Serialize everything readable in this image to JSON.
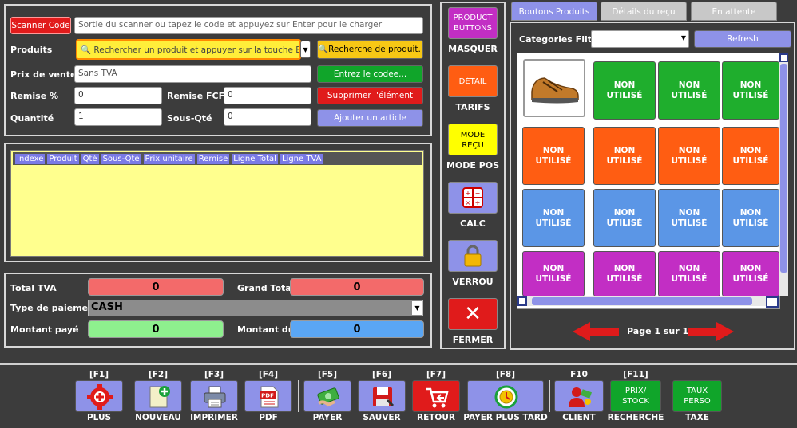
{
  "scanner": {
    "button": "Scanner Code",
    "placeholder": "Sortie du scanner ou tapez le code et appuyez sur Enter pour le charger"
  },
  "produits": {
    "label": "Produits",
    "placeholder": "Rechercher un produit et appuyer sur la touche Ente...",
    "search_button": "Recherche de produit..."
  },
  "prix_vente": {
    "label": "Prix de vente",
    "value": "Sans TVA",
    "button": "Entrez le codee..."
  },
  "remise": {
    "label": "Remise %",
    "value": "0",
    "fcfa_label": "Remise FCFA",
    "fcfa_value": "0",
    "button": "Supprimer l'élément"
  },
  "quantite": {
    "label": "Quantité",
    "value": "1",
    "sous_label": "Sous-Qté",
    "sous_value": "0",
    "button": "Ajouter un article"
  },
  "table": {
    "columns": [
      "Indexe",
      "Produit",
      "Qté",
      "Sous-Qté",
      "Prix unitaire",
      "Remise",
      "Ligne Total",
      "Ligne TVA"
    ]
  },
  "totals": {
    "tva_label": "Total TVA",
    "tva_value": "0",
    "grand_label": "Grand Total",
    "grand_value": "0",
    "paiement_label": "Type de paiement",
    "paiement_value": "CASH",
    "paye_label": "Montant payé",
    "paye_value": "0",
    "du_label": "Montant dû",
    "du_value": "0"
  },
  "side": {
    "product_buttons": "PRODUCT BUTTONS",
    "masquer": "MASQUER",
    "detail": "DÉTAIL",
    "tarifs": "TARIFS",
    "mode_recu": "MODE REÇU",
    "mode_pos": "MODE POS",
    "calc": "CALC",
    "verrou": "VERROU",
    "fermer": "FERMER"
  },
  "tabs": [
    "Boutons Produits",
    "Détails du reçu",
    "En attente"
  ],
  "filter": {
    "label": "Categories Filter",
    "value": "",
    "refresh": "Refresh"
  },
  "tiles": {
    "label_line1": "NON",
    "label_line2": "UTILISÉ",
    "colors": {
      "green": "#1fae2d",
      "orange": "#ff5d12",
      "blue": "#5b96e6",
      "purple": "#c22ec4"
    }
  },
  "pager": {
    "text": "Page 1 sur 1"
  },
  "toolbar": [
    {
      "key": "[F1]",
      "label": "PLUS",
      "icon": "gear-plus-icon"
    },
    {
      "key": "[F2]",
      "label": "NOUVEAU",
      "icon": "new-document-icon"
    },
    {
      "key": "[F3]",
      "label": "IMPRIMER",
      "icon": "printer-icon"
    },
    {
      "key": "[F4]",
      "label": "PDF",
      "icon": "pdf-icon"
    },
    {
      "key": "[F5]",
      "label": "PAYER",
      "icon": "money-icon"
    },
    {
      "key": "[F6]",
      "label": "SAUVER",
      "icon": "save-icon"
    },
    {
      "key": "[F7]",
      "label": "RETOUR",
      "icon": "cart-return-icon"
    },
    {
      "key": "[F8]",
      "label": "PAYER PLUS TARD",
      "icon": "clock-money-icon"
    },
    {
      "key": "F10",
      "label": "CLIENT",
      "icon": "client-icon"
    },
    {
      "key": "[F11]",
      "label": "RECHERCHE",
      "text": "PRIX/ STOCK"
    },
    {
      "key": "",
      "label": "TAXE",
      "text": "TAUX PERSO"
    }
  ]
}
